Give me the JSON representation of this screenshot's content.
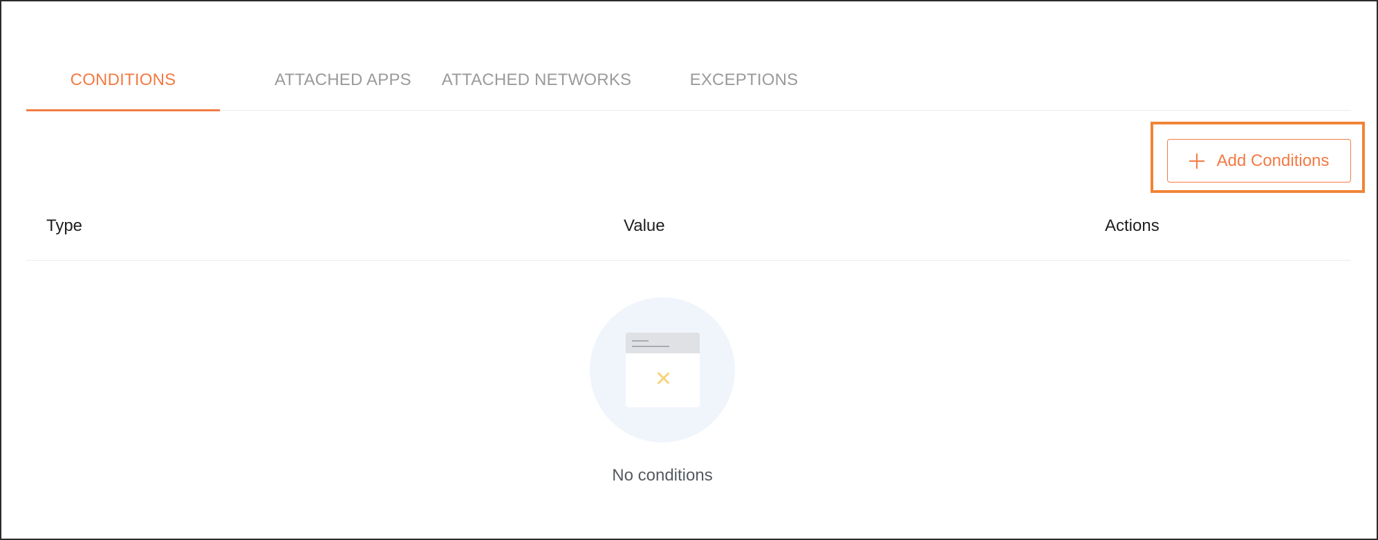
{
  "tabs": [
    {
      "label": "CONDITIONS",
      "active": true
    },
    {
      "label": "ATTACHED APPS",
      "active": false
    },
    {
      "label": "ATTACHED NETWORKS",
      "active": false
    },
    {
      "label": "EXCEPTIONS",
      "active": false
    }
  ],
  "toolbar": {
    "add_label": "Add Conditions",
    "add_icon": "plus-icon"
  },
  "table": {
    "columns": [
      "Type",
      "Value",
      "Actions"
    ],
    "rows": []
  },
  "empty_state": {
    "icon": "empty-window-icon",
    "text": "No conditions"
  },
  "colors": {
    "accent": "#f37a44",
    "highlight": "#f28436",
    "tab_inactive": "#9a9a9a"
  }
}
